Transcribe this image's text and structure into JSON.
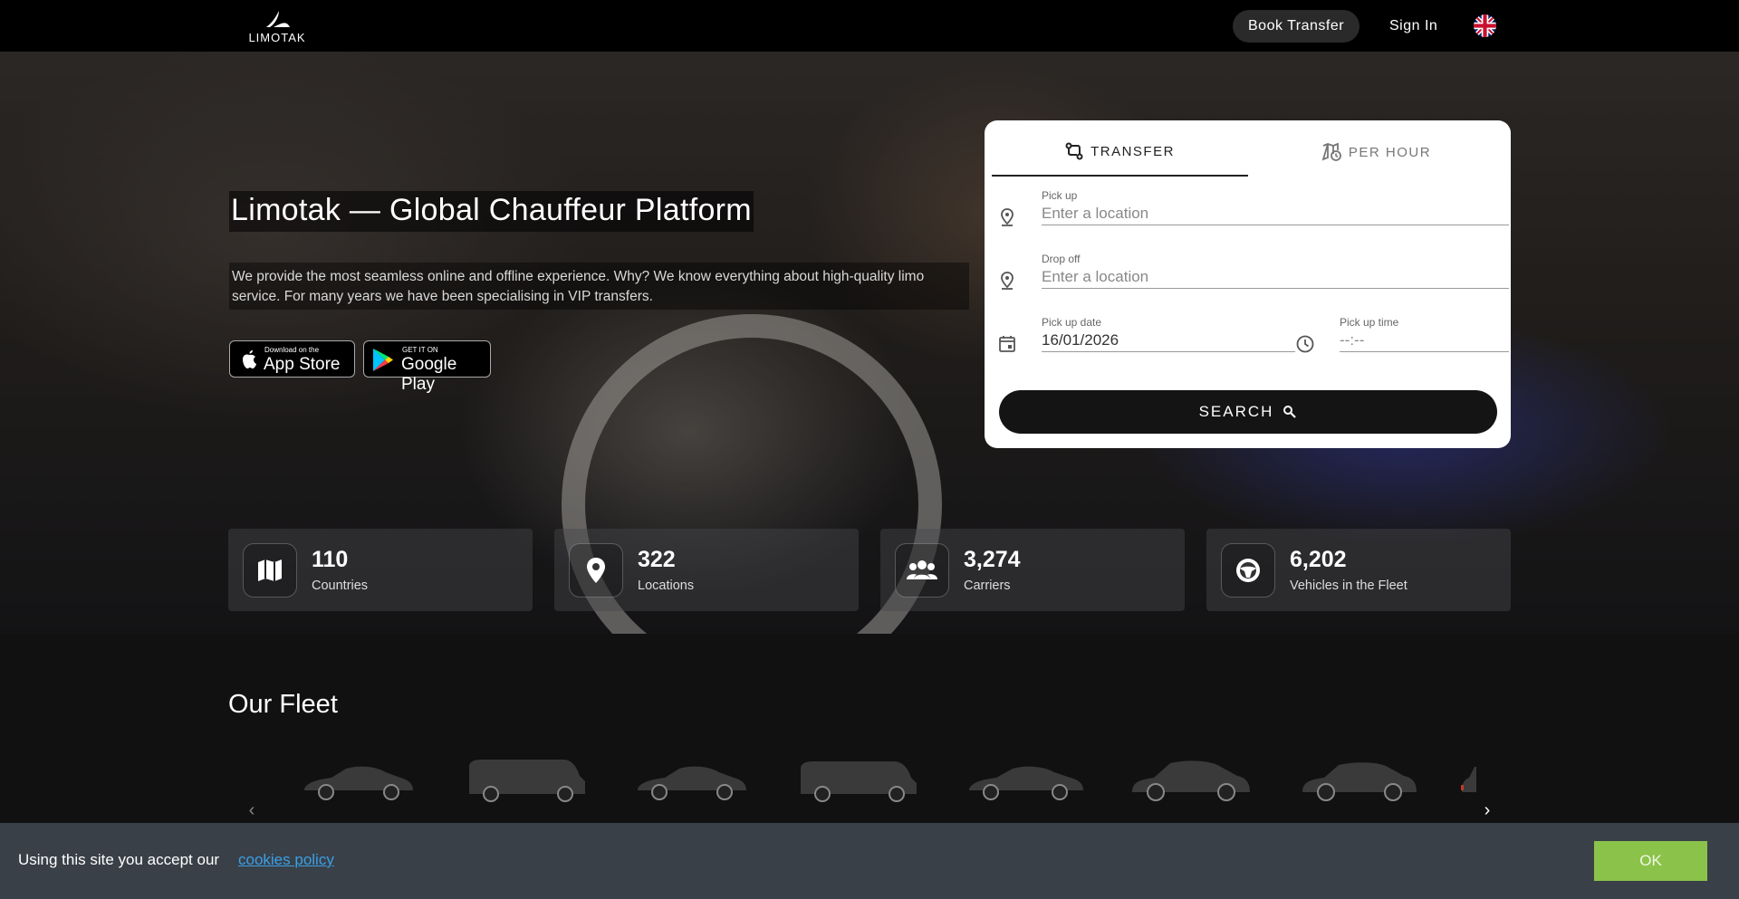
{
  "header": {
    "logo_text": "LIMOTAK",
    "book_transfer": "Book Transfer",
    "sign_in": "Sign In",
    "language_flag": "uk-flag-icon"
  },
  "hero": {
    "title": "Limotak — Global Chauffeur Platform",
    "description": "We provide the most seamless online and offline experience. Why? We know everything about high-quality limo service. For many years we have been specialising in VIP transfers.",
    "app_store": {
      "small": "Download on the",
      "big": "App Store"
    },
    "google_play": {
      "small": "GET IT ON",
      "big": "Google Play"
    }
  },
  "booking": {
    "tabs": [
      {
        "label": "TRANSFER",
        "icon": "route-icon",
        "active": true
      },
      {
        "label": "PER HOUR",
        "icon": "map-clock-icon",
        "active": false
      }
    ],
    "pickup": {
      "label": "Pick up",
      "placeholder": "Enter a location"
    },
    "dropoff": {
      "label": "Drop off",
      "placeholder": "Enter a location"
    },
    "date": {
      "label": "Pick up date",
      "value": "16/01/2026"
    },
    "time": {
      "label": "Pick up time",
      "placeholder": "--:--"
    },
    "search_label": "SEARCH"
  },
  "stats": [
    {
      "value": "110",
      "label": "Countries",
      "icon": "map-icon"
    },
    {
      "value": "322",
      "label": "Locations",
      "icon": "location-pin-icon"
    },
    {
      "value": "3,274",
      "label": "Carriers",
      "icon": "people-icon"
    },
    {
      "value": "6,202",
      "label": "Vehicles in the Fleet",
      "icon": "steering-wheel-icon"
    }
  ],
  "fleet": {
    "title": "Our Fleet"
  },
  "cookie": {
    "text": "Using this site you accept our",
    "link": "cookies policy",
    "ok": "OK"
  },
  "colors": {
    "accent_ok": "#8bc34a",
    "link": "#39a0e6",
    "cookie_bg": "#3a4048"
  }
}
